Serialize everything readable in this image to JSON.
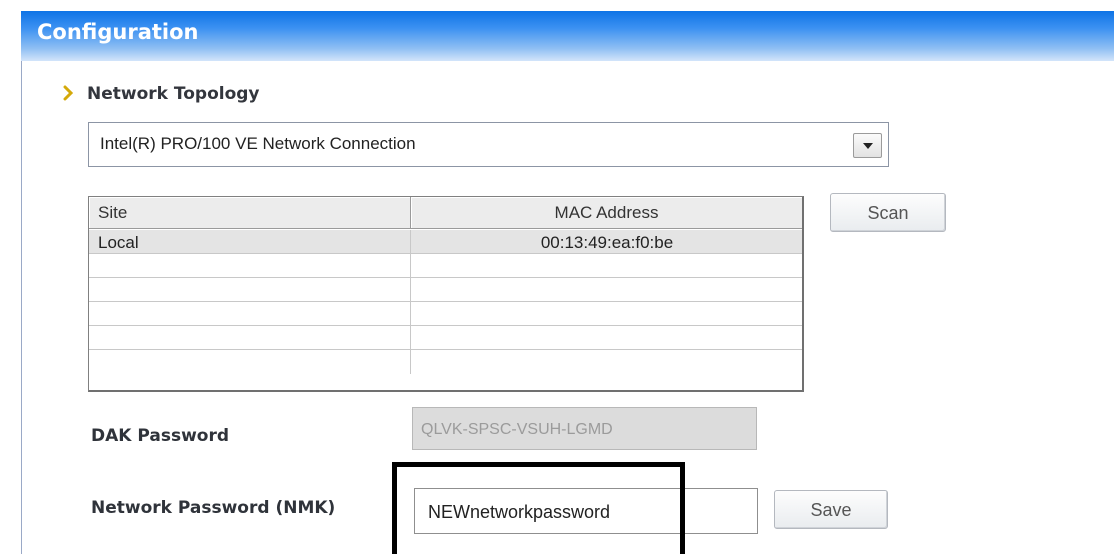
{
  "panel": {
    "title": "Configuration"
  },
  "network_topology": {
    "section_title": "Network Topology",
    "adapter_value": "Intel(R) PRO/100 VE Network Connection"
  },
  "site_table": {
    "columns": [
      "Site",
      "MAC Address"
    ],
    "rows": [
      {
        "site": "Local",
        "mac": "00:13:49:ea:f0:be"
      },
      {
        "site": "",
        "mac": ""
      },
      {
        "site": "",
        "mac": ""
      },
      {
        "site": "",
        "mac": ""
      },
      {
        "site": "",
        "mac": ""
      }
    ]
  },
  "buttons": {
    "scan_label": "Scan",
    "save_label": "Save"
  },
  "dak": {
    "label": "DAK Password",
    "value": "QLVK-SPSC-VSUH-LGMD"
  },
  "nmk": {
    "label": "Network Password (NMK)",
    "value": "NEWnetworkpassword"
  },
  "colors": {
    "title_bar": "#0e73e6",
    "arrow_accent": "#d4a90a",
    "highlight_border": "#000000"
  },
  "icons": {
    "section_arrow": "chevron-right-icon",
    "dropdown": "chevron-down-icon"
  }
}
